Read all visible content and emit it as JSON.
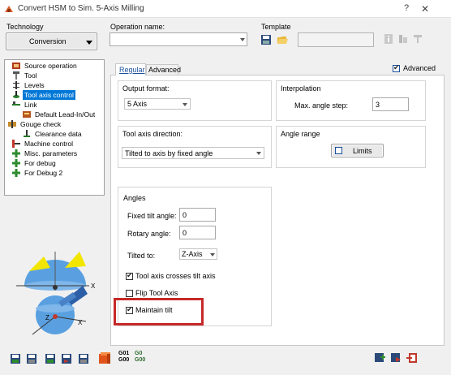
{
  "window": {
    "title": "Convert HSM to Sim. 5-Axis Milling",
    "help": "?",
    "close": "✕"
  },
  "technology": {
    "label": "Technology",
    "value": "Conversion"
  },
  "operation_name": {
    "label": "Operation name:",
    "value": ""
  },
  "template": {
    "label": "Template",
    "value": ""
  },
  "tree": {
    "items": [
      {
        "label": "Source operation",
        "icon": "source-operation-icon",
        "selected": false
      },
      {
        "label": "Tool",
        "icon": "tool-icon",
        "selected": false
      },
      {
        "label": "Levels",
        "icon": "levels-icon",
        "selected": false
      },
      {
        "label": "Tool axis control",
        "icon": "tool-axis-icon",
        "selected": true
      },
      {
        "label": "Link",
        "icon": "link-icon",
        "selected": false
      },
      {
        "label": "Default Lead-In/Out",
        "icon": "lead-in-out-icon",
        "selected": false
      },
      {
        "label": "Gouge check",
        "icon": "gouge-check-icon",
        "selected": false
      },
      {
        "label": "Clearance data",
        "icon": "clearance-data-icon",
        "selected": false
      },
      {
        "label": "Machine control",
        "icon": "machine-control-icon",
        "selected": false
      },
      {
        "label": "Misc. parameters",
        "icon": "plus-icon",
        "selected": false
      },
      {
        "label": "For debug",
        "icon": "plus-icon",
        "selected": false
      },
      {
        "label": "For Debug 2",
        "icon": "plus-icon",
        "selected": false
      }
    ]
  },
  "tabs": {
    "regular": "Regular",
    "advanced": "Advanced"
  },
  "advanced_checkbox": {
    "label": "Advanced",
    "checked": true
  },
  "output_format": {
    "label": "Output format:",
    "value": "5 Axis"
  },
  "interpolation": {
    "label": "Interpolation",
    "max_angle_label": "Max. angle step:",
    "max_angle_value": "3"
  },
  "tool_axis_direction": {
    "label": "Tool axis direction:",
    "value": "Tilted to axis by fixed angle"
  },
  "angle_range": {
    "label": "Angle range",
    "limits_label": "Limits"
  },
  "angles": {
    "label": "Angles",
    "fixed_tilt_label": "Fixed tilt angle:",
    "fixed_tilt_value": "0",
    "rotary_label": "Rotary angle:",
    "rotary_value": "0",
    "tilted_to_label": "Tilted to:",
    "tilted_to_value": "Z-Axis",
    "crosses_label": "Tool axis crosses tilt axis",
    "crosses_checked": true,
    "flip_label": "Flip Tool Axis",
    "flip_checked": false,
    "maintain_label": "Maintain tilt",
    "maintain_checked": true
  },
  "illustration": {
    "x1": "X",
    "x2": "X",
    "z": "Z"
  },
  "bottom_toolbar": {
    "g_label_1": "G01\nG00",
    "g_label_2": "G0\nG00"
  },
  "colors": {
    "highlight": "#c62828",
    "selection": "#0078d7"
  }
}
